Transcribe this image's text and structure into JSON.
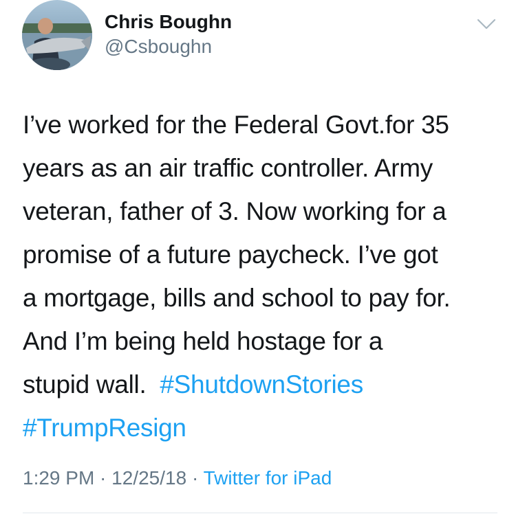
{
  "user": {
    "name": "Chris Boughn",
    "handle": "@Csboughn"
  },
  "tweet": {
    "lines": [
      "I’ve worked for the Federal Govt.for 35",
      "years as an air traffic controller.  Army",
      "veteran, father of 3.  Now working for a",
      "promise of a future paycheck. I’ve got",
      "a mortgage, bills and school to pay for.",
      "And I’m being held hostage for a",
      "stupid wall.  "
    ],
    "hashtags": [
      "#ShutdownStories",
      "#TrumpResign"
    ]
  },
  "meta": {
    "time": "1:29 PM",
    "separator": " · ",
    "date": "12/25/18",
    "separator2": " · ",
    "source": "Twitter for iPad"
  },
  "colors": {
    "link": "#1da1f2",
    "secondary": "#657786",
    "text": "#14171a"
  }
}
